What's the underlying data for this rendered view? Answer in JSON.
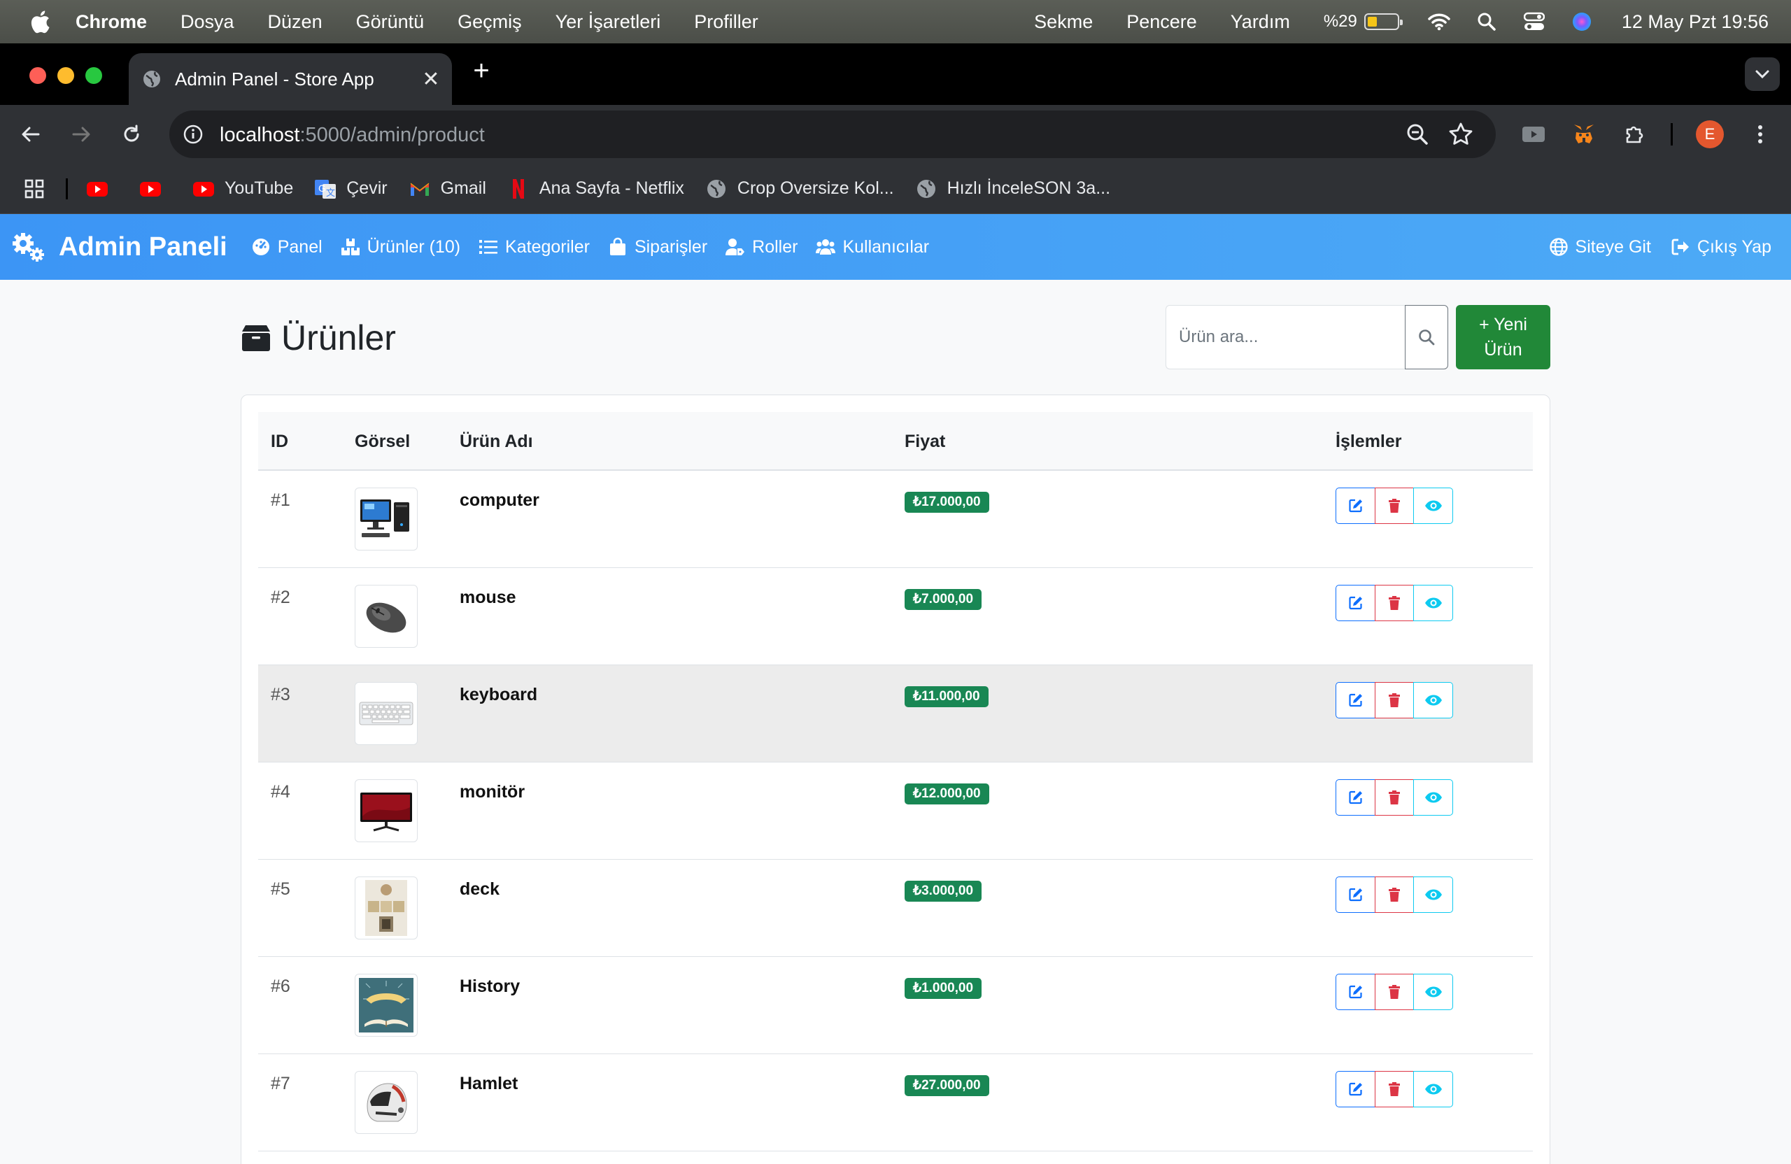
{
  "macos": {
    "menu": [
      "Chrome",
      "Dosya",
      "Düzen",
      "Görüntü",
      "Geçmiş",
      "Yer İşaretleri",
      "Profiller"
    ],
    "menu_right": [
      "Sekme",
      "Pencere",
      "Yardım"
    ],
    "battery_percent": "%29",
    "battery_level": 0.29,
    "clock": "12 May Pzt  19:56"
  },
  "browser": {
    "tab_title": "Admin Panel - Store App",
    "url_host": "localhost",
    "url_path": ":5000/admin/product",
    "profile_initial": "E",
    "bookmarks": [
      {
        "label": "",
        "icon": "youtube-icon"
      },
      {
        "label": "",
        "icon": "youtube-icon"
      },
      {
        "label": "YouTube",
        "icon": "youtube-icon"
      },
      {
        "label": "Çevir",
        "icon": "translate-icon"
      },
      {
        "label": "Gmail",
        "icon": "gmail-icon"
      },
      {
        "label": "Ana Sayfa - Netflix",
        "icon": "netflix-icon"
      },
      {
        "label": "Crop Oversize Kol...",
        "icon": "globe-icon"
      },
      {
        "label": "Hızlı İnceleSON 3a...",
        "icon": "globe-icon"
      }
    ]
  },
  "appnav": {
    "brand": "Admin Paneli",
    "links": [
      {
        "label": "Panel",
        "icon": "dashboard-icon"
      },
      {
        "label": "Ürünler (10)",
        "icon": "boxes-icon"
      },
      {
        "label": "Kategoriler",
        "icon": "list-icon"
      },
      {
        "label": "Siparişler",
        "icon": "shopping-bag-icon"
      },
      {
        "label": "Roller",
        "icon": "user-tag-icon"
      },
      {
        "label": "Kullanıcılar",
        "icon": "users-icon"
      }
    ],
    "right_links": [
      {
        "label": "Siteye Git",
        "icon": "globe-icon"
      },
      {
        "label": "Çıkış Yap",
        "icon": "logout-icon"
      }
    ]
  },
  "page": {
    "title": "Ürünler",
    "search_placeholder": "Ürün ara...",
    "new_button_line1": "+ Yeni",
    "new_button_line2": "Ürün"
  },
  "table": {
    "headers": {
      "id": "ID",
      "image": "Görsel",
      "name": "Ürün Adı",
      "price": "Fiyat",
      "actions": "İşlemler"
    },
    "rows": [
      {
        "id": "#1",
        "name": "computer",
        "price": "₺17.000,00",
        "image": "computer-image"
      },
      {
        "id": "#2",
        "name": "mouse",
        "price": "₺7.000,00",
        "image": "mouse-image"
      },
      {
        "id": "#3",
        "name": "keyboard",
        "price": "₺11.000,00",
        "image": "keyboard-image"
      },
      {
        "id": "#4",
        "name": "monitör",
        "price": "₺12.000,00",
        "image": "monitor-image"
      },
      {
        "id": "#5",
        "name": "deck",
        "price": "₺3.000,00",
        "image": "deck-image"
      },
      {
        "id": "#6",
        "name": "History",
        "price": "₺1.000,00",
        "image": "history-book-image"
      },
      {
        "id": "#7",
        "name": "Hamlet",
        "price": "₺27.000,00",
        "image": "helmet-image"
      }
    ]
  },
  "colors": {
    "navbar": "#3c95f5",
    "success": "#198754",
    "edit": "#0d6efd",
    "delete": "#dc3545",
    "view": "#0dcaf0"
  }
}
